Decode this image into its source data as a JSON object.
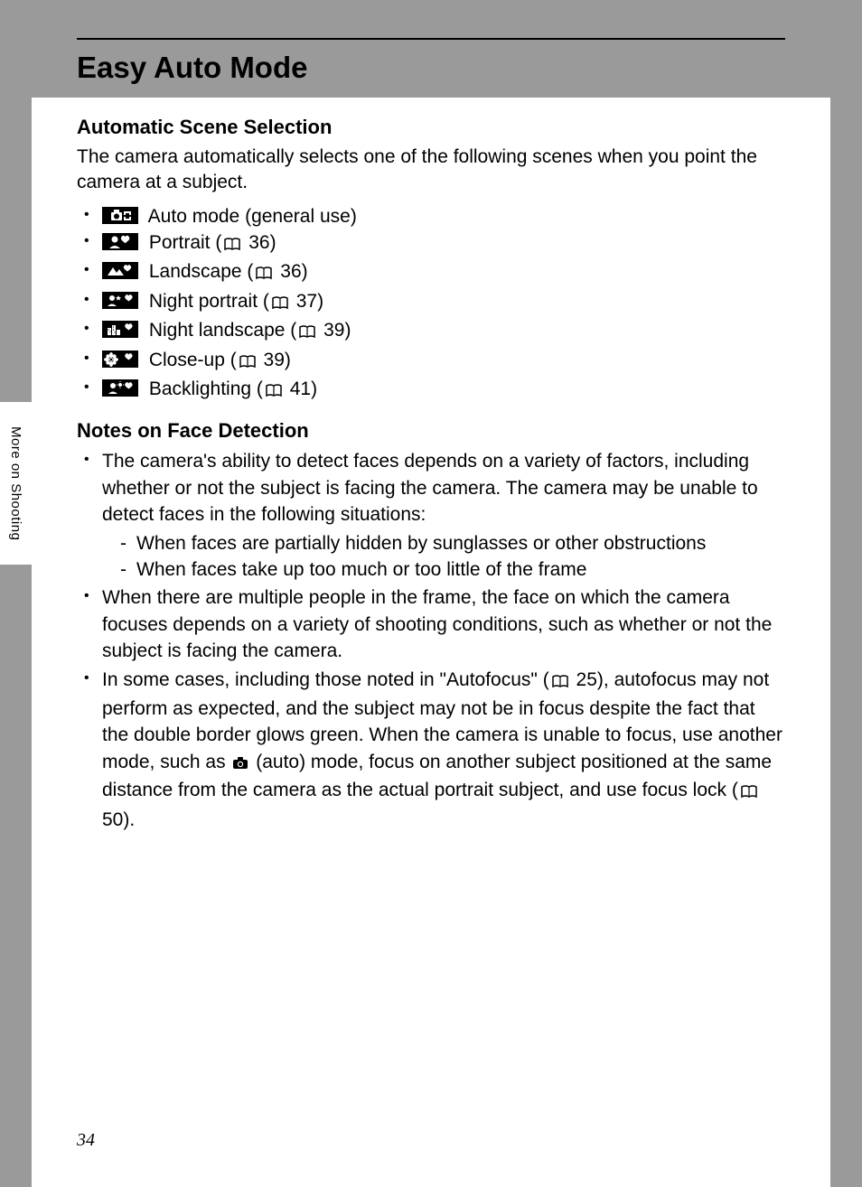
{
  "side_tab": "More on Shooting",
  "page_number": "34",
  "chapter_title": "Easy Auto Mode",
  "section1": {
    "heading": "Automatic Scene Selection",
    "intro": "The camera automatically selects one of the following scenes when you point the camera at a subject.",
    "scenes": [
      {
        "label_pre": " Auto mode (general use)",
        "ref": ""
      },
      {
        "label_pre": " Portrait (",
        "ref": "36",
        "label_post": ")"
      },
      {
        "label_pre": " Landscape (",
        "ref": "36",
        "label_post": ")"
      },
      {
        "label_pre": " Night portrait (",
        "ref": "37",
        "label_post": ")"
      },
      {
        "label_pre": " Night landscape (",
        "ref": "39",
        "label_post": ")"
      },
      {
        "label_pre": " Close-up (",
        "ref": "39",
        "label_post": ")"
      },
      {
        "label_pre": " Backlighting (",
        "ref": "41",
        "label_post": ")"
      }
    ]
  },
  "section2": {
    "heading": "Notes on Face Detection",
    "notes": {
      "n1": "The camera's ability to detect faces depends on a variety of factors, including whether or not the subject is facing the camera. The camera may be unable to detect faces in the following situations:",
      "n1a": "When faces are partially hidden by sunglasses or other obstructions",
      "n1b": "When faces take up too much or too little of the frame",
      "n2": "When there are multiple people in the frame, the face on which the camera focuses depends on a variety of shooting conditions, such as whether or not the subject is facing the camera.",
      "n3_a": "In some cases, including those noted in \"Autofocus\" (",
      "n3_ref1": "25",
      "n3_b": "), autofocus may not perform as expected, and the subject may not be in focus despite the fact that the double border glows green. When the camera is unable to focus, use another mode, such as ",
      "n3_c": " (auto) mode, focus on another subject positioned at the same distance from the camera as the actual portrait subject, and use focus lock (",
      "n3_ref2": "50",
      "n3_d": ")."
    }
  }
}
